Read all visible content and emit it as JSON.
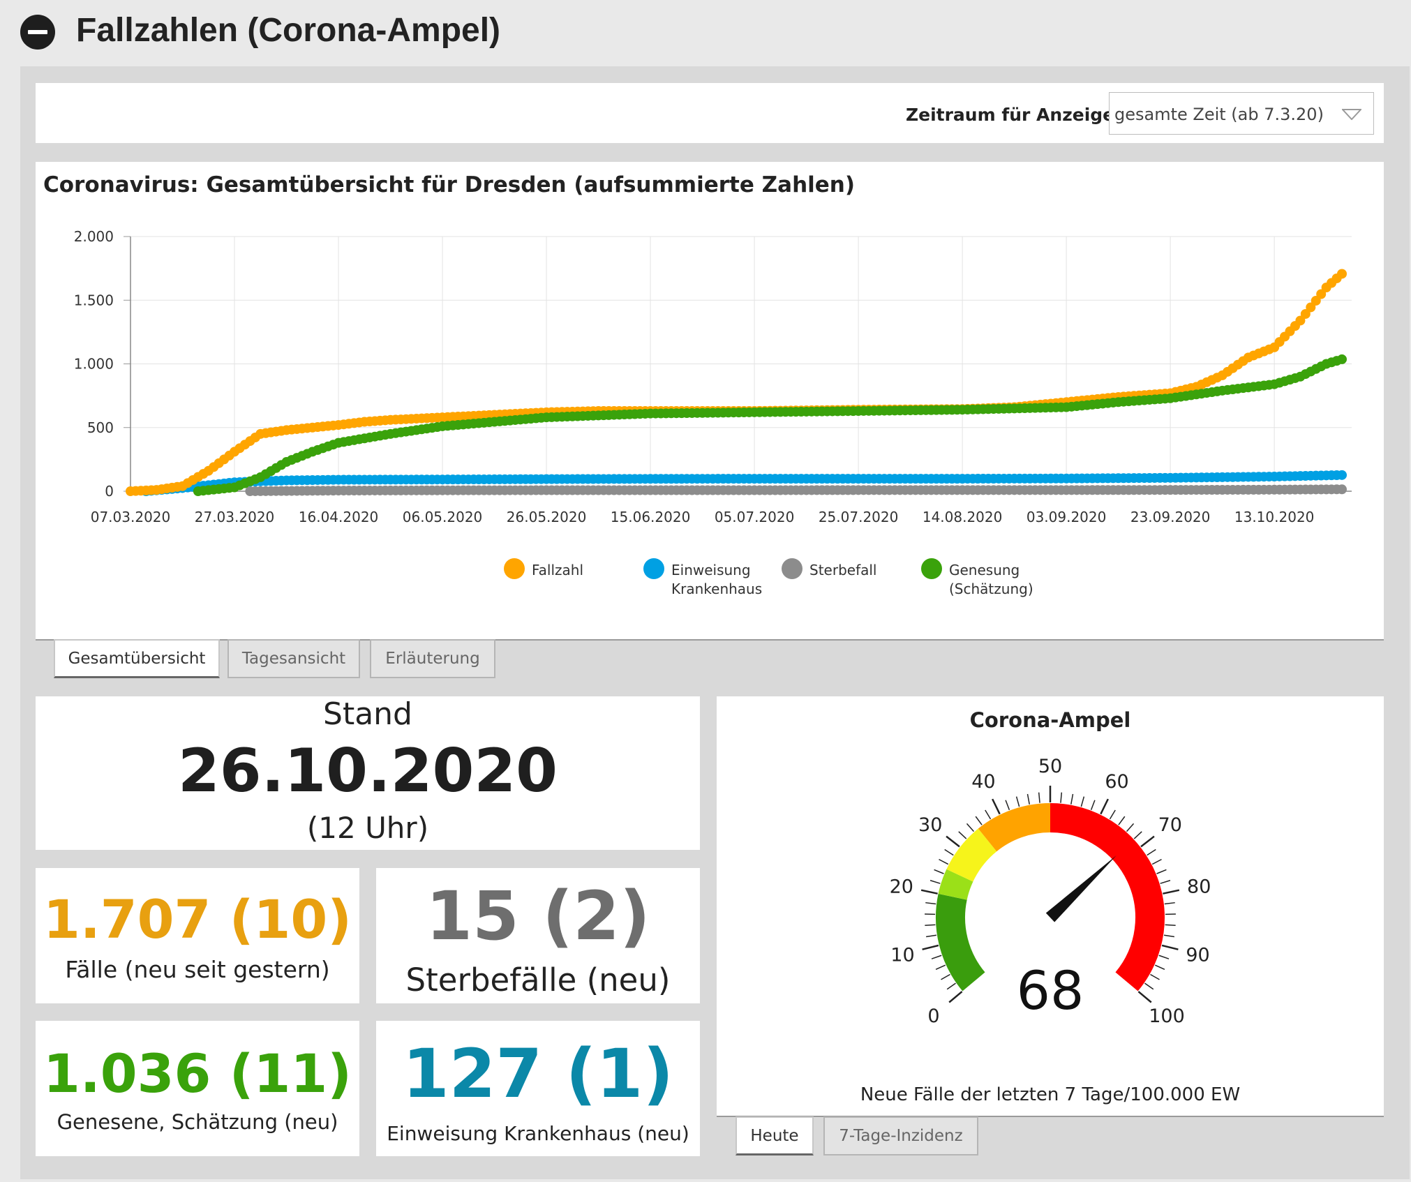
{
  "header": {
    "title": "Fallzahlen (Corona-Ampel)"
  },
  "filter": {
    "label": "Zeitraum für Anzeige:",
    "selected": "gesamte Zeit (ab 7.3.20)"
  },
  "chart_tabs": [
    "Gesamtübersicht",
    "Tagesansicht",
    "Erläuterung"
  ],
  "stand": {
    "label": "Stand",
    "date": "26.10.2020",
    "time": "(12 Uhr)"
  },
  "stats": {
    "faelle": {
      "value": "1.707 (10)",
      "label": "Fälle (neu seit gestern)"
    },
    "sterbefaelle": {
      "value": "15 (2)",
      "label": "Sterbefälle (neu)"
    },
    "genesene": {
      "value": "1.036 (11)",
      "label": "Genesene, Schätzung (neu)"
    },
    "einweisung": {
      "value": "127 (1)",
      "label": "Einweisung Krankenhaus (neu)"
    }
  },
  "gauge": {
    "title": "Corona-Ampel",
    "value": 68,
    "display_value": "68",
    "min": 0,
    "max": 100,
    "labels": [
      "0",
      "10",
      "20",
      "30",
      "40",
      "50",
      "60",
      "70",
      "80",
      "90",
      "100"
    ],
    "bands": [
      {
        "from": 0,
        "to": 20,
        "color": "#3a9d0d"
      },
      {
        "from": 20,
        "to": 25,
        "color": "#9be018"
      },
      {
        "from": 25,
        "to": 35,
        "color": "#f6f41b"
      },
      {
        "from": 35,
        "to": 50,
        "color": "#ffa300"
      },
      {
        "from": 50,
        "to": 100,
        "color": "#ff0000"
      }
    ],
    "caption": "Neue Fälle der letzten 7 Tage/100.000 EW"
  },
  "gauge_tabs": [
    "Heute",
    "7-Tage-Inzidenz"
  ],
  "colors": {
    "fallzahl": "#ffa500",
    "einweisung": "#00a0e3",
    "sterbefall": "#8c8c8c",
    "genesung": "#3aa20b",
    "faelle_text": "#e8a010",
    "sterbe_text": "#6e6e6e",
    "genesene_text": "#3aa20b",
    "einweisung_text": "#0b88a8"
  },
  "chart_data": {
    "type": "scatter",
    "title": "Coronavirus: Gesamtübersicht für Dresden (aufsummierte Zahlen)",
    "xlabel": "",
    "ylabel": "",
    "x_range": [
      "07.03.2020",
      "26.10.2020"
    ],
    "x_ticks": [
      "07.03.2020",
      "27.03.2020",
      "16.04.2020",
      "06.05.2020",
      "26.05.2020",
      "15.06.2020",
      "05.07.2020",
      "25.07.2020",
      "14.08.2020",
      "03.09.2020",
      "23.09.2020",
      "13.10.2020"
    ],
    "ylim": [
      0,
      2000
    ],
    "y_ticks": [
      "0",
      "500",
      "1.000",
      "1.500",
      "2.000"
    ],
    "grid": true,
    "legend": "bottom-center",
    "series": [
      {
        "name": "Fallzahl",
        "x": [
          "07.03.2020",
          "12.03.2020",
          "17.03.2020",
          "22.03.2020",
          "27.03.2020",
          "01.04.2020",
          "06.04.2020",
          "11.04.2020",
          "16.04.2020",
          "21.04.2020",
          "26.04.2020",
          "01.05.2020",
          "06.05.2020",
          "16.05.2020",
          "26.05.2020",
          "05.06.2020",
          "15.06.2020",
          "05.07.2020",
          "25.07.2020",
          "14.08.2020",
          "24.08.2020",
          "03.09.2020",
          "13.09.2020",
          "23.09.2020",
          "28.09.2020",
          "03.10.2020",
          "08.10.2020",
          "13.10.2020",
          "18.10.2020",
          "23.10.2020",
          "26.10.2020"
        ],
        "y": [
          0,
          10,
          40,
          160,
          310,
          450,
          480,
          500,
          520,
          545,
          560,
          570,
          580,
          600,
          620,
          630,
          630,
          630,
          640,
          645,
          660,
          700,
          740,
          770,
          820,
          910,
          1050,
          1130,
          1340,
          1600,
          1707
        ]
      },
      {
        "name": "Einweisung Krankenhaus",
        "x": [
          "10.03.2020",
          "17.03.2020",
          "27.03.2020",
          "06.04.2020",
          "16.04.2020",
          "06.05.2020",
          "26.05.2020",
          "15.06.2020",
          "05.07.2020",
          "25.07.2020",
          "14.08.2020",
          "03.09.2020",
          "23.09.2020",
          "13.10.2020",
          "26.10.2020"
        ],
        "y": [
          0,
          25,
          70,
          85,
          90,
          92,
          95,
          97,
          98,
          98,
          98,
          100,
          105,
          115,
          127
        ]
      },
      {
        "name": "Sterbefall",
        "x": [
          "30.03.2020",
          "16.04.2020",
          "06.05.2020",
          "26.05.2020",
          "15.06.2020",
          "05.07.2020",
          "25.07.2020",
          "14.08.2020",
          "03.09.2020",
          "23.09.2020",
          "13.10.2020",
          "26.10.2020"
        ],
        "y": [
          0,
          5,
          7,
          8,
          8,
          8,
          9,
          9,
          9,
          10,
          12,
          15
        ]
      },
      {
        "name": "Genesung (Schätzung)",
        "x": [
          "20.03.2020",
          "27.03.2020",
          "01.04.2020",
          "06.04.2020",
          "11.04.2020",
          "16.04.2020",
          "26.04.2020",
          "06.05.2020",
          "16.05.2020",
          "26.05.2020",
          "15.06.2020",
          "05.07.2020",
          "25.07.2020",
          "14.08.2020",
          "24.08.2020",
          "03.09.2020",
          "13.09.2020",
          "23.09.2020",
          "03.10.2020",
          "13.10.2020",
          "18.10.2020",
          "23.10.2020",
          "26.10.2020"
        ],
        "y": [
          0,
          30,
          110,
          230,
          310,
          380,
          450,
          510,
          545,
          580,
          610,
          620,
          630,
          640,
          650,
          660,
          700,
          730,
          790,
          840,
          900,
          1000,
          1036
        ]
      }
    ]
  }
}
